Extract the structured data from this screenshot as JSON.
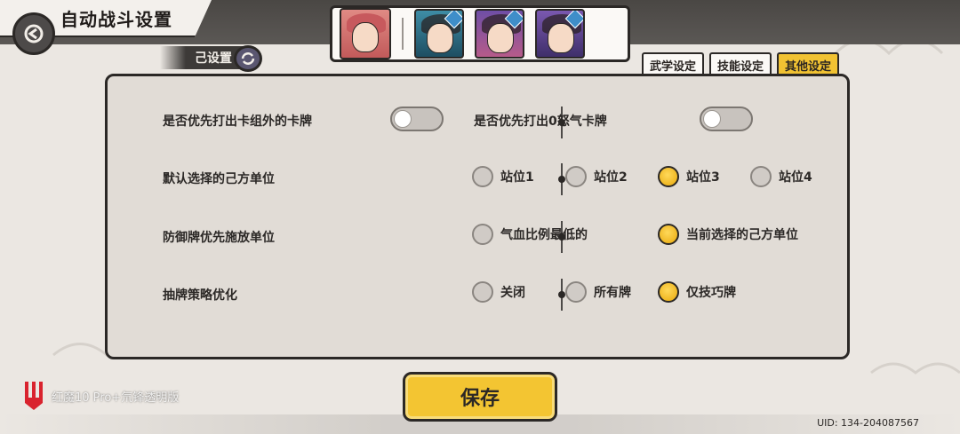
{
  "header": {
    "title": "自动战斗设置",
    "sub_tag": "己设置"
  },
  "tabs": [
    {
      "label": "武学设定",
      "active": false
    },
    {
      "label": "技能设定",
      "active": false
    },
    {
      "label": "其他设定",
      "active": true
    }
  ],
  "settings": {
    "row1": {
      "left_label": "是否优先打出卡组外的卡牌",
      "left_toggle_on": false,
      "right_label": "是否优先打出0怒气卡牌",
      "right_toggle_on": false
    },
    "row2": {
      "label": "默认选择的己方单位",
      "options": [
        "站位1",
        "站位2",
        "站位3",
        "站位4"
      ],
      "selected": "站位3"
    },
    "row3": {
      "label": "防御牌优先施放单位",
      "options": [
        "气血比例最低的",
        "当前选择的己方单位"
      ],
      "selected": "当前选择的己方单位"
    },
    "row4": {
      "label": "抽牌策略优化",
      "options": [
        "关闭",
        "所有牌",
        "仅技巧牌"
      ],
      "selected": "仅技巧牌"
    }
  },
  "save_label": "保存",
  "watermark": "红魔10 Pro+氘锋透明版",
  "uid": "UID: 134-204087567",
  "colors": {
    "accent": "#f3c532",
    "outline": "#2b2826",
    "panel": "#e1dcd6"
  }
}
